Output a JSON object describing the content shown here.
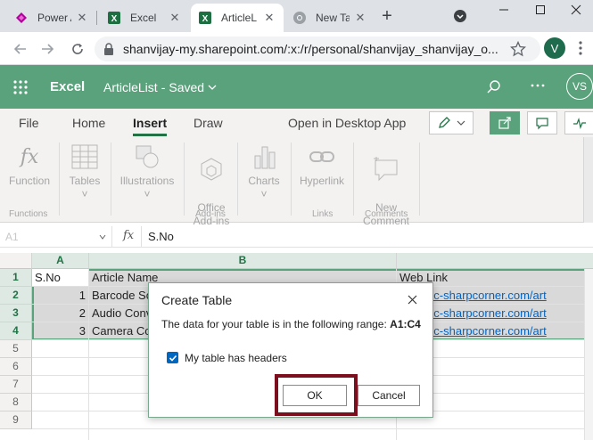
{
  "browser": {
    "tabs": [
      {
        "title": "Power A",
        "icon": "power-automate-icon",
        "active": false
      },
      {
        "title": "Excel",
        "icon": "excel-icon",
        "active": false
      },
      {
        "title": "ArticleL",
        "icon": "excel-icon",
        "active": true
      },
      {
        "title": "New Ta",
        "icon": "chrome-icon",
        "active": false
      }
    ],
    "new_tab_glyph": "+",
    "url": "shanvijay-my.sharepoint.com/:x:/r/personal/shanvijay_shanvijay_o...",
    "profile_initial": "V",
    "colors": {
      "tabstrip": "#dee1e6",
      "profile": "#1e6b4e"
    }
  },
  "app": {
    "name": "Excel",
    "doc_title": "ArticleList",
    "save_state": "Saved",
    "user_initials": "VS",
    "colors": {
      "header": "#5aa27c",
      "accent": "#217346"
    }
  },
  "ribbon": {
    "tabs": [
      "File",
      "Home",
      "Insert",
      "Draw",
      "Open in Desktop App"
    ],
    "active_tab": "Insert",
    "groups": [
      {
        "label": "Function",
        "group": "Functions"
      },
      {
        "label": "Tables",
        "group": ""
      },
      {
        "label": "Illustrations",
        "group": ""
      },
      {
        "label": "Office\nAdd-ins",
        "group": "Add-ins"
      },
      {
        "label": "Charts",
        "group": ""
      },
      {
        "label": "Hyperlink",
        "group": "Links"
      },
      {
        "label": "New\nComment",
        "group": "Comments"
      }
    ],
    "group_labels": {
      "functions": "Functions",
      "addins": "Add-ins",
      "links": "Links",
      "comments": "Comments"
    },
    "tables_caret": "˅",
    "illus_caret": "˅",
    "charts_caret": "˅"
  },
  "formula_bar": {
    "name_box": "A1",
    "fx": "fx",
    "value": "S.No"
  },
  "sheet": {
    "columns": [
      "A",
      "B"
    ],
    "rows": [
      "1",
      "2",
      "3",
      "4",
      "5",
      "6",
      "7",
      "8",
      "9"
    ],
    "cells": {
      "A1": "S.No",
      "B1": "Article Name",
      "C1": "Web Link",
      "A2": "1",
      "B2": "Barcode Sc",
      "C2": "//www.c-sharpcorner.com/art",
      "A3": "2",
      "B3": "Audio Conv",
      "C3": "//www.c-sharpcorner.com/art",
      "A4": "3",
      "B4": "Camera Co",
      "C4": "//www.c-sharpcorner.com/art"
    }
  },
  "dialog": {
    "title": "Create Table",
    "message_prefix": "The data for your table is in the following range:",
    "range": "A1:C4",
    "checkbox_label": "My table has headers",
    "checkbox_checked": true,
    "ok_label": "OK",
    "cancel_label": "Cancel",
    "highlight_color": "#7b0f1d"
  }
}
